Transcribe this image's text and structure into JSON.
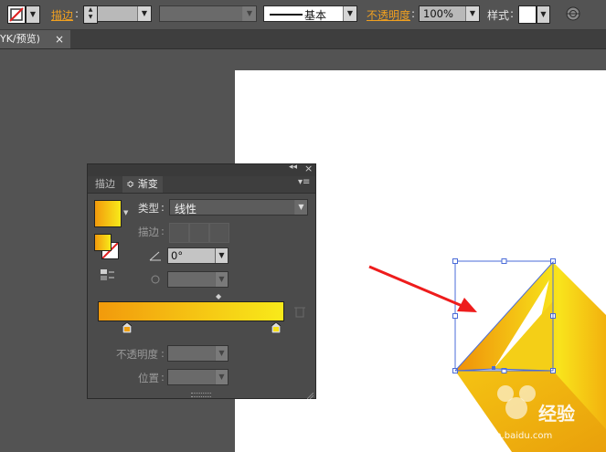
{
  "control_bar": {
    "stroke_label": "描边",
    "opacity_label": "不透明度",
    "opacity_value": "100%",
    "stroke_profile_label": "基本",
    "style_label": "样式"
  },
  "document_tab": {
    "title": "YK/预览)",
    "close_glyph": "×"
  },
  "gradient_panel": {
    "collapse_glyph": "◂◂",
    "close_glyph": "×",
    "menu_glyph": "▾≡",
    "tab_stroke": "描边",
    "tab_gradient_prefix": "≎",
    "tab_gradient": "渐变",
    "type_label": "类型",
    "type_value": "线性",
    "stroke_label": "描边",
    "angle_value": "0°",
    "opacity_label": "不透明度",
    "location_label": "位置",
    "stop_colors": [
      "#f0a010",
      "#f6e018"
    ],
    "colors": {
      "start": "#f29a0c",
      "end": "#f8ea1a"
    }
  },
  "watermark": {
    "brand": "经验",
    "url": "jingyan.baidu.com"
  },
  "annotation": {
    "arrow_color": "#ee1c1c"
  }
}
